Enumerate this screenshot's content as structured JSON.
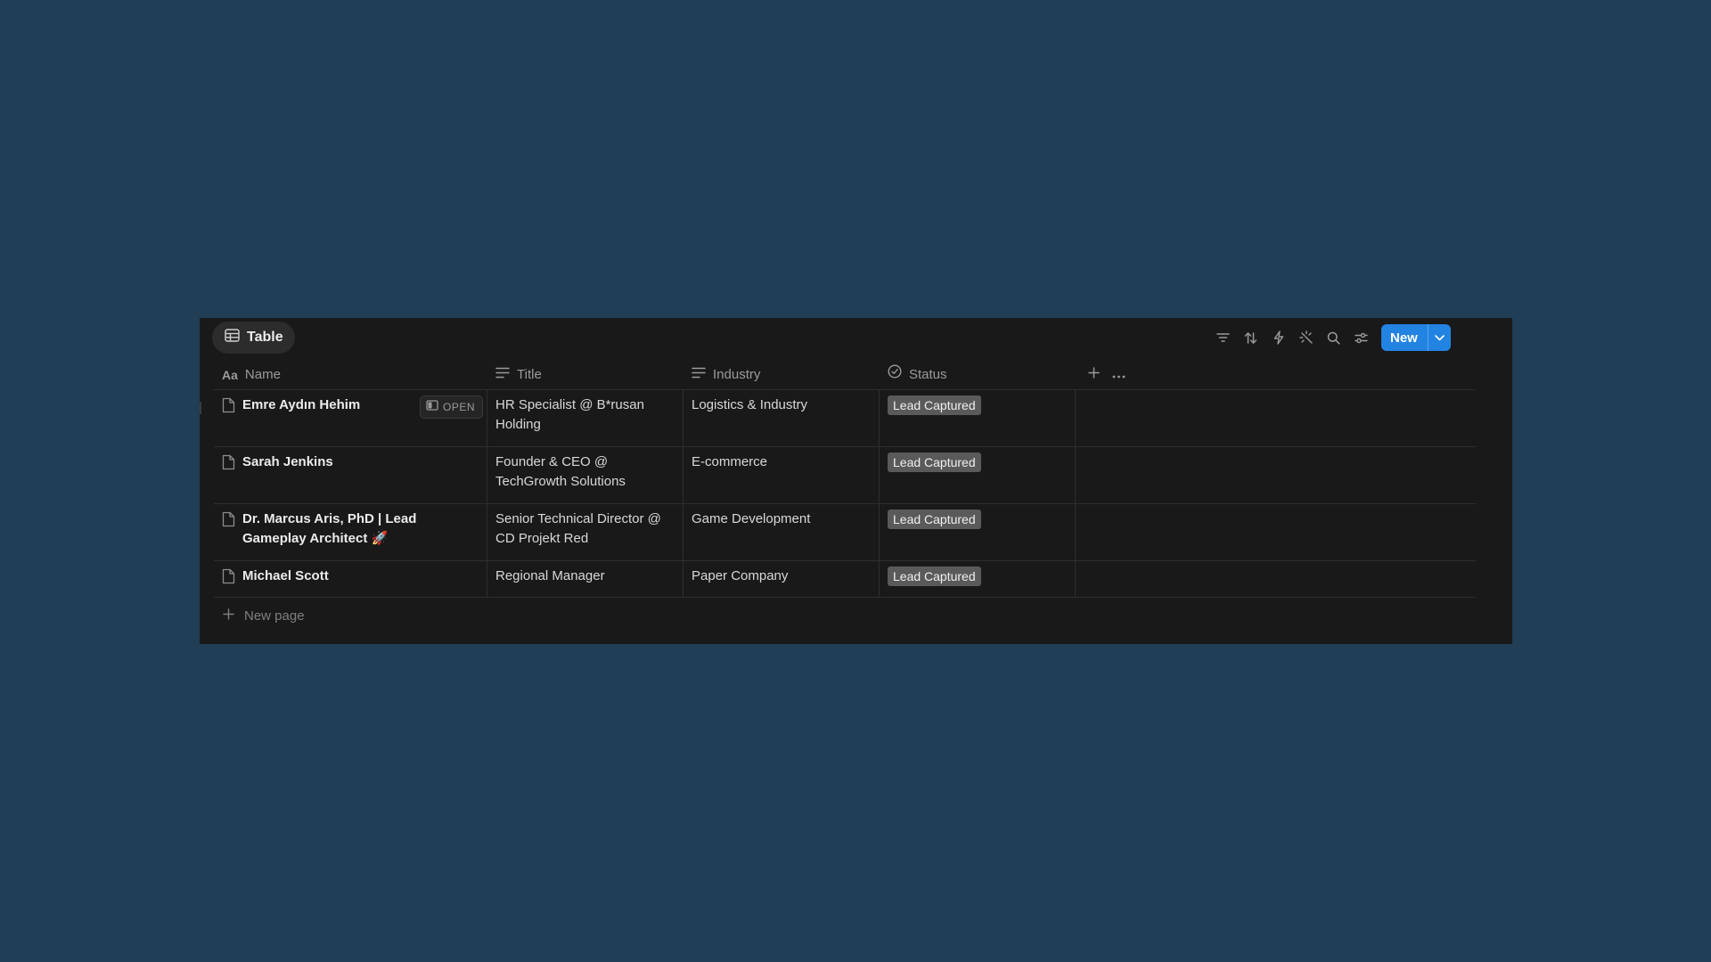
{
  "toolbar": {
    "view_tab_label": "Table",
    "view_tab_icon": "table-icon",
    "icons": [
      "filter-icon",
      "sort-icon",
      "automation-bolt-icon",
      "sparkle-ai-icon",
      "search-icon",
      "settings-sliders-icon"
    ],
    "new_label": "New",
    "new_button_color": "#2383e2"
  },
  "columns": {
    "name": "Name",
    "title": "Title",
    "industry": "Industry",
    "status": "Status"
  },
  "rows": [
    {
      "name": "Emre Aydın Hehim",
      "open_label": "OPEN",
      "title": "HR Specialist @ B*rusan Holding",
      "industry": "Logistics & Industry",
      "status": "Lead Captured"
    },
    {
      "name": "Sarah Jenkins",
      "title": "Founder & CEO @ TechGrowth Solutions",
      "industry": "E-commerce",
      "status": "Lead Captured"
    },
    {
      "name": "Dr. Marcus Aris, PhD | Lead Gameplay Architect 🚀",
      "title": "Senior Technical Director @ CD Projekt Red",
      "industry": "Game Development",
      "status": "Lead Captured"
    },
    {
      "name": "Michael Scott",
      "title": "Regional Manager",
      "industry": "Paper Company",
      "status": "Lead Captured"
    }
  ],
  "new_page_label": "New page",
  "colors": {
    "background": "#203e55",
    "panel": "#191919",
    "status_badge": "#5a5a5a"
  }
}
